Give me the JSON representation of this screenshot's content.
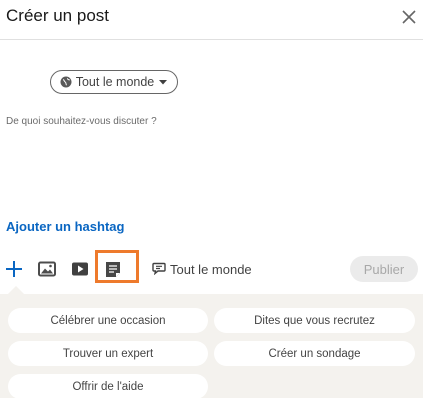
{
  "dialog": {
    "title": "Créer un post",
    "close_icon": "close-icon"
  },
  "audience": {
    "label": "Tout le monde",
    "globe_icon": "globe-icon",
    "caret_icon": "caret-down-icon"
  },
  "editor": {
    "placeholder": "De quoi souhaitez-vous discuter ?"
  },
  "hashtag": {
    "label": "Ajouter un hashtag"
  },
  "toolbar": {
    "icons": [
      "plus-icon",
      "photo-icon",
      "video-icon",
      "document-icon"
    ],
    "visibility_label": "Tout le monde",
    "visibility_icon": "comment-icon",
    "publish_label": "Publier",
    "highlight_color": "#ee7a2c"
  },
  "suggestions": {
    "items": [
      "Célébrer une occasion",
      "Dites que vous recrutez",
      "Trouver un expert",
      "Créer un sondage",
      "Offrir de l'aide"
    ]
  },
  "colors": {
    "link": "#0a66c2",
    "panel_bg": "#f4f2ee",
    "publish_disabled_bg": "#ebebeb",
    "publish_disabled_text": "#a8a8a8"
  }
}
